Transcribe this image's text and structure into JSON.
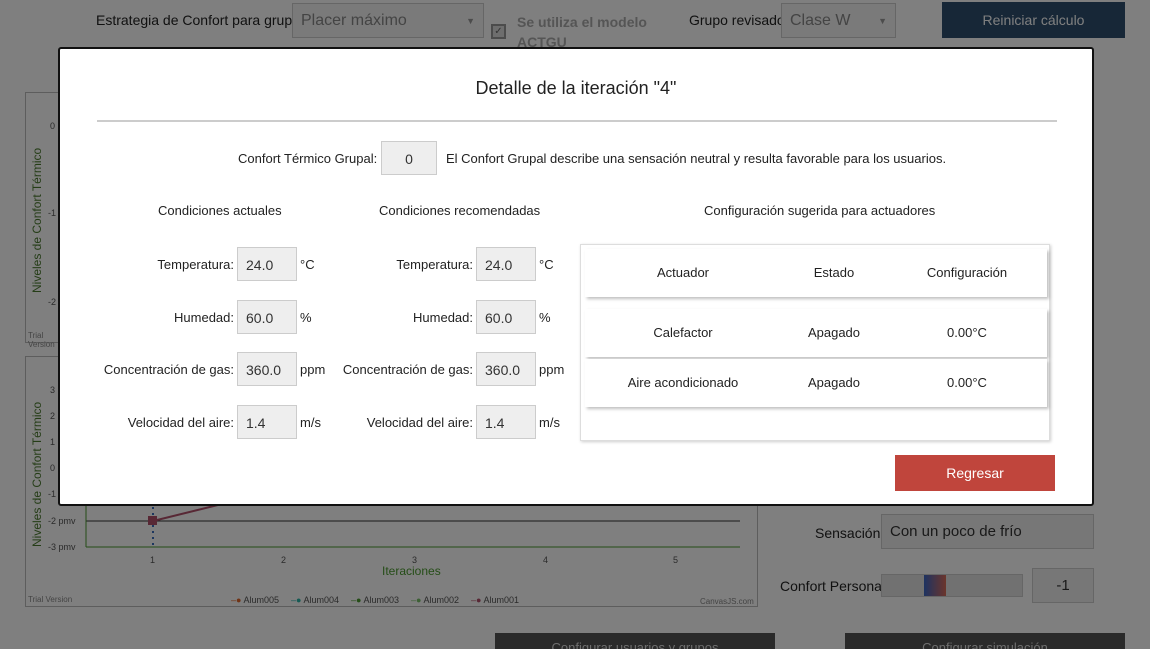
{
  "topbar": {
    "strategy_label": "Estrategia de Confort para grupos:",
    "strategy_value": "Placer máximo",
    "model_note": "Se utiliza el modelo ACTGU",
    "group_label": "Grupo revisado:",
    "group_value": "Clase W",
    "reset_button": "Reiniciar cálculo"
  },
  "chart1": {
    "ylabel": "Niveles de Confort Térmico",
    "yticks": [
      "0",
      "-1",
      "-2"
    ],
    "trial": "Trial Version"
  },
  "chart2": {
    "ylabel": "Niveles de Confort Térmico",
    "yticks": [
      "3",
      "2",
      "1",
      "0",
      "-1",
      "-2 pmv",
      "-3 pmv"
    ],
    "xticks": [
      "1",
      "2",
      "3",
      "4",
      "5"
    ],
    "xlabel": "Iteraciones",
    "trial": "Trial Version",
    "credit": "CanvasJS.com",
    "legend": [
      "Alum005",
      "Alum004",
      "Alum003",
      "Alum002",
      "Alum001"
    ],
    "legend_colors": [
      "#e0662b",
      "#2bb5a8",
      "#4b9a2f",
      "#7ac16b",
      "#b0506b"
    ]
  },
  "chart_data": {
    "type": "line",
    "xlabel": "Iteraciones",
    "ylabel": "Niveles de Confort Térmico",
    "x": [
      1,
      2,
      3,
      4,
      5
    ],
    "ylim": [
      -3,
      3
    ],
    "legend": [
      "Alum005",
      "Alum004",
      "Alum003",
      "Alum002",
      "Alum001"
    ],
    "legend_placement": "bottom"
  },
  "side": {
    "sensation_label": "Sensación:",
    "sensation_value": "Con un poco de frío",
    "personal_label": "Confort Personal:",
    "personal_value": "-1"
  },
  "bottom": {
    "users_button": "Configurar usuarios y grupos",
    "sim_button": "Configurar simulación"
  },
  "modal": {
    "title": "Detalle de la iteración \"4\"",
    "group_comfort_label": "Confort Térmico Grupal:",
    "group_comfort_value": "0",
    "group_comfort_desc": "El Confort Grupal describe una sensación neutral y resulta favorable para los usuarios.",
    "current": {
      "heading": "Condiciones actuales",
      "temp_label": "Temperatura:",
      "temp_value": "24.0",
      "temp_unit": "°C",
      "hum_label": "Humedad:",
      "hum_value": "60.0",
      "hum_unit": "%",
      "gas_label": "Concentración de gas:",
      "gas_value": "360.0",
      "gas_unit": "ppm",
      "air_label": "Velocidad del aire:",
      "air_value": "1.4",
      "air_unit": "m/s"
    },
    "recommended": {
      "heading": "Condiciones recomendadas",
      "temp_label": "Temperatura:",
      "temp_value": "24.0",
      "temp_unit": "°C",
      "hum_label": "Humedad:",
      "hum_value": "60.0",
      "hum_unit": "%",
      "gas_label": "Concentración de gas:",
      "gas_value": "360.0",
      "gas_unit": "ppm",
      "air_label": "Velocidad del aire:",
      "air_value": "1.4",
      "air_unit": "m/s"
    },
    "actuators": {
      "heading": "Configuración sugerida para actuadores",
      "headers": [
        "Actuador",
        "Estado",
        "Configuración"
      ],
      "rows": [
        [
          "Calefactor",
          "Apagado",
          "0.00°C"
        ],
        [
          "Aire acondicionado",
          "Apagado",
          "0.00°C"
        ]
      ]
    },
    "back_button": "Regresar"
  }
}
